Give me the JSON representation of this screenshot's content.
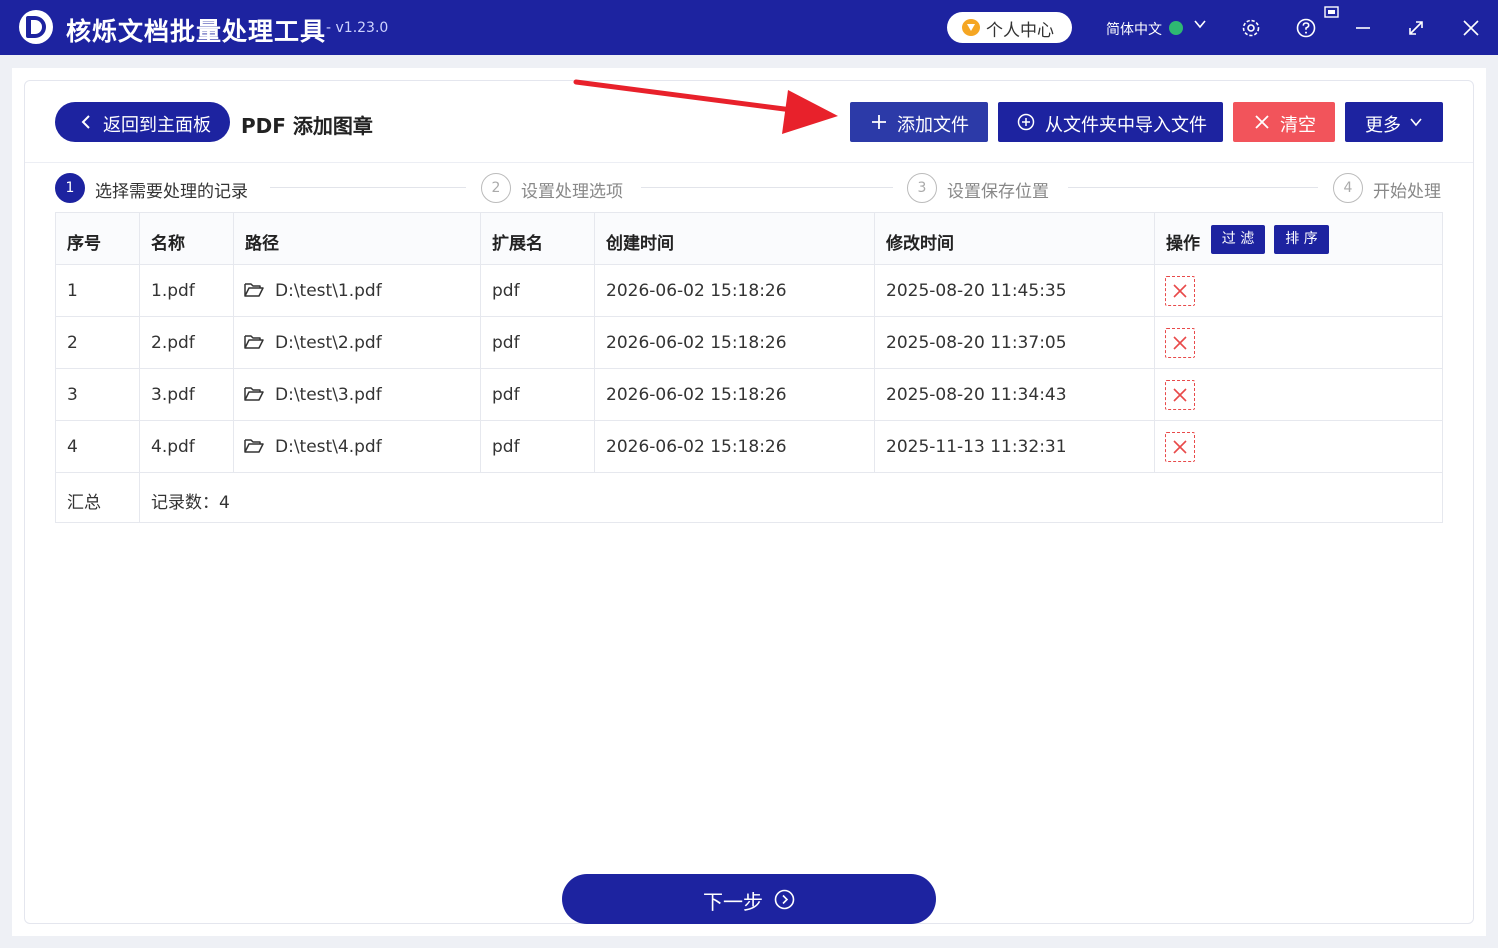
{
  "titlebar": {
    "app_name": "核烁文档批量处理工具",
    "version": "- v1.23.0",
    "user_center": "个人中心",
    "language": "简体中文",
    "icons": [
      "settings-icon",
      "help-icon",
      "screenshot-icon",
      "minimize-icon",
      "maximize-icon",
      "close-icon"
    ]
  },
  "header": {
    "back_label": "返回到主面板",
    "page_title": "PDF 添加图章",
    "add_file": "添加文件",
    "import_folder": "从文件夹中导入文件",
    "clear": "清空",
    "more": "更多"
  },
  "steps": [
    {
      "num": "1",
      "label": "选择需要处理的记录"
    },
    {
      "num": "2",
      "label": "设置处理选项"
    },
    {
      "num": "3",
      "label": "设置保存位置"
    },
    {
      "num": "4",
      "label": "开始处理"
    }
  ],
  "table": {
    "headers": {
      "index": "序号",
      "name": "名称",
      "path": "路径",
      "ext": "扩展名",
      "created": "创建时间",
      "modified": "修改时间",
      "action": "操作",
      "filter": "过 滤",
      "sort": "排 序"
    },
    "rows": [
      {
        "index": "1",
        "name": "1.pdf",
        "path": "D:\\test\\1.pdf",
        "ext": "pdf",
        "created": "2026-06-02 15:18:26",
        "modified": "2025-08-20 11:45:35"
      },
      {
        "index": "2",
        "name": "2.pdf",
        "path": "D:\\test\\2.pdf",
        "ext": "pdf",
        "created": "2026-06-02 15:18:26",
        "modified": "2025-08-20 11:37:05"
      },
      {
        "index": "3",
        "name": "3.pdf",
        "path": "D:\\test\\3.pdf",
        "ext": "pdf",
        "created": "2026-06-02 15:18:26",
        "modified": "2025-08-20 11:34:43"
      },
      {
        "index": "4",
        "name": "4.pdf",
        "path": "D:\\test\\4.pdf",
        "ext": "pdf",
        "created": "2026-06-02 15:18:26",
        "modified": "2025-11-13 11:32:31"
      }
    ],
    "summary_label": "汇总",
    "summary_value": "记录数：4"
  },
  "footer": {
    "next_label": "下一步"
  },
  "colors": {
    "primary": "#1d23a0",
    "danger": "#f2545b",
    "arrow": "#e8212b"
  }
}
